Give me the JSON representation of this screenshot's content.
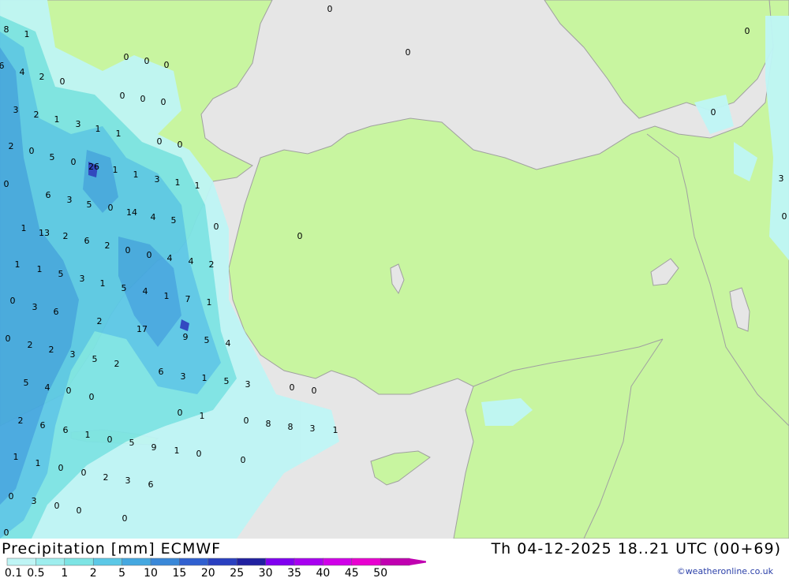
{
  "title": "Precipitation [mm] ECMWF",
  "valid_time": "Th 04-12-2025 18..21 UTC (00+69)",
  "credit": "©weatheronline.co.uk",
  "colors": {
    "sea": "#e6e6e6",
    "land": "#c8f5a0",
    "border": "#a0a0a0"
  },
  "legend": {
    "ticks": [
      "0.1",
      "0.5",
      "1",
      "2",
      "5",
      "10",
      "15",
      "20",
      "25",
      "30",
      "35",
      "40",
      "45",
      "50"
    ],
    "colors": [
      "#bff5f5",
      "#9eeeee",
      "#7de4e4",
      "#5cc8e6",
      "#45a8e0",
      "#3a88d8",
      "#3060d0",
      "#2a40c0",
      "#2020a0",
      "#8000f0",
      "#a800f0",
      "#d000e8",
      "#e800d0",
      "#c000b0"
    ]
  },
  "value_labels": [
    "0",
    "8",
    "1",
    "6",
    "4",
    "2",
    "0",
    "0",
    "0",
    "0",
    "0",
    "0",
    "0",
    "0",
    "0",
    "3",
    "2",
    "1",
    "3",
    "1",
    "1",
    "2",
    "0",
    "5",
    "0",
    "26",
    "1",
    "1",
    "3",
    "1",
    "1",
    "0",
    "0",
    "0",
    "6",
    "3",
    "5",
    "0",
    "14",
    "4",
    "5",
    "0",
    "1",
    "13",
    "2",
    "6",
    "2",
    "0",
    "0",
    "0",
    "4",
    "4",
    "2",
    "1",
    "1",
    "5",
    "3",
    "1",
    "5",
    "4",
    "1",
    "7",
    "1",
    "0",
    "3",
    "6",
    "2",
    "17",
    "9",
    "5",
    "4",
    "0",
    "2",
    "2",
    "3",
    "5",
    "2",
    "0",
    "3",
    "0",
    "6",
    "3",
    "1",
    "5",
    "3",
    "5",
    "4",
    "0",
    "0",
    "0",
    "0",
    "0",
    "1",
    "0",
    "8",
    "8",
    "3",
    "1",
    "2",
    "6",
    "6",
    "1",
    "0",
    "5",
    "9",
    "1",
    "0",
    "1",
    "1",
    "0",
    "0",
    "2",
    "3",
    "6",
    "0",
    "0",
    "3",
    "0",
    "0",
    "0",
    "0",
    "0"
  ]
}
